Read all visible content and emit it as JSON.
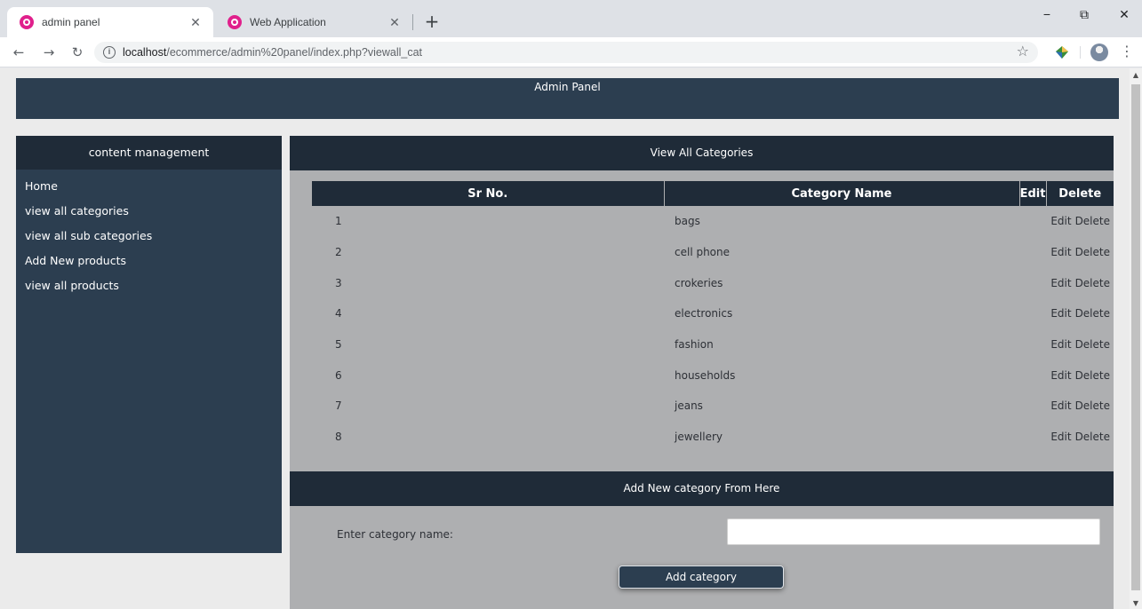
{
  "browser": {
    "tabs": [
      {
        "title": "admin panel",
        "active": true
      },
      {
        "title": "Web Application",
        "active": false
      }
    ],
    "new_tab": "+",
    "window_controls": {
      "minimize": "−",
      "restore": "⧉",
      "close": "✕"
    },
    "nav": {
      "back": "←",
      "forward": "→",
      "reload": "↻"
    },
    "url_host": "localhost",
    "url_path": "/ecommerce/admin%20panel/index.php?viewall_cat",
    "info_glyph": "i",
    "star_glyph": "☆",
    "menu_glyph": "⋮",
    "tab_close": "✕"
  },
  "header": {
    "title": "Admin Panel"
  },
  "sidebar": {
    "title": "content management",
    "items": [
      {
        "label": "Home"
      },
      {
        "label": "view all categories"
      },
      {
        "label": "view all sub categories"
      },
      {
        "label": "Add New products"
      },
      {
        "label": "view all products"
      }
    ]
  },
  "categories": {
    "title": "View All Categories",
    "columns": {
      "sr": "Sr No.",
      "name": "Category Name",
      "edit": "Edit",
      "delete": "Delete"
    },
    "rows": [
      {
        "sr": "1",
        "name": "bags",
        "edit": "Edit",
        "delete": "Delete"
      },
      {
        "sr": "2",
        "name": "cell phone",
        "edit": "Edit",
        "delete": "Delete"
      },
      {
        "sr": "3",
        "name": "crokeries",
        "edit": "Edit",
        "delete": "Delete"
      },
      {
        "sr": "4",
        "name": "electronics",
        "edit": "Edit",
        "delete": "Delete"
      },
      {
        "sr": "5",
        "name": "fashion",
        "edit": "Edit",
        "delete": "Delete"
      },
      {
        "sr": "6",
        "name": "households",
        "edit": "Edit",
        "delete": "Delete"
      },
      {
        "sr": "7",
        "name": "jeans",
        "edit": "Edit",
        "delete": "Delete"
      },
      {
        "sr": "8",
        "name": "jewellery",
        "edit": "Edit",
        "delete": "Delete"
      }
    ]
  },
  "add_category": {
    "title": "Add New category From Here",
    "label": "Enter category name:",
    "input_value": "",
    "button_label": "Add category"
  },
  "colors": {
    "header_bg": "#2c3e50",
    "bar_bg": "#1f2b38",
    "content_bg": "#aeafb1",
    "favicon": "#e0208c"
  }
}
